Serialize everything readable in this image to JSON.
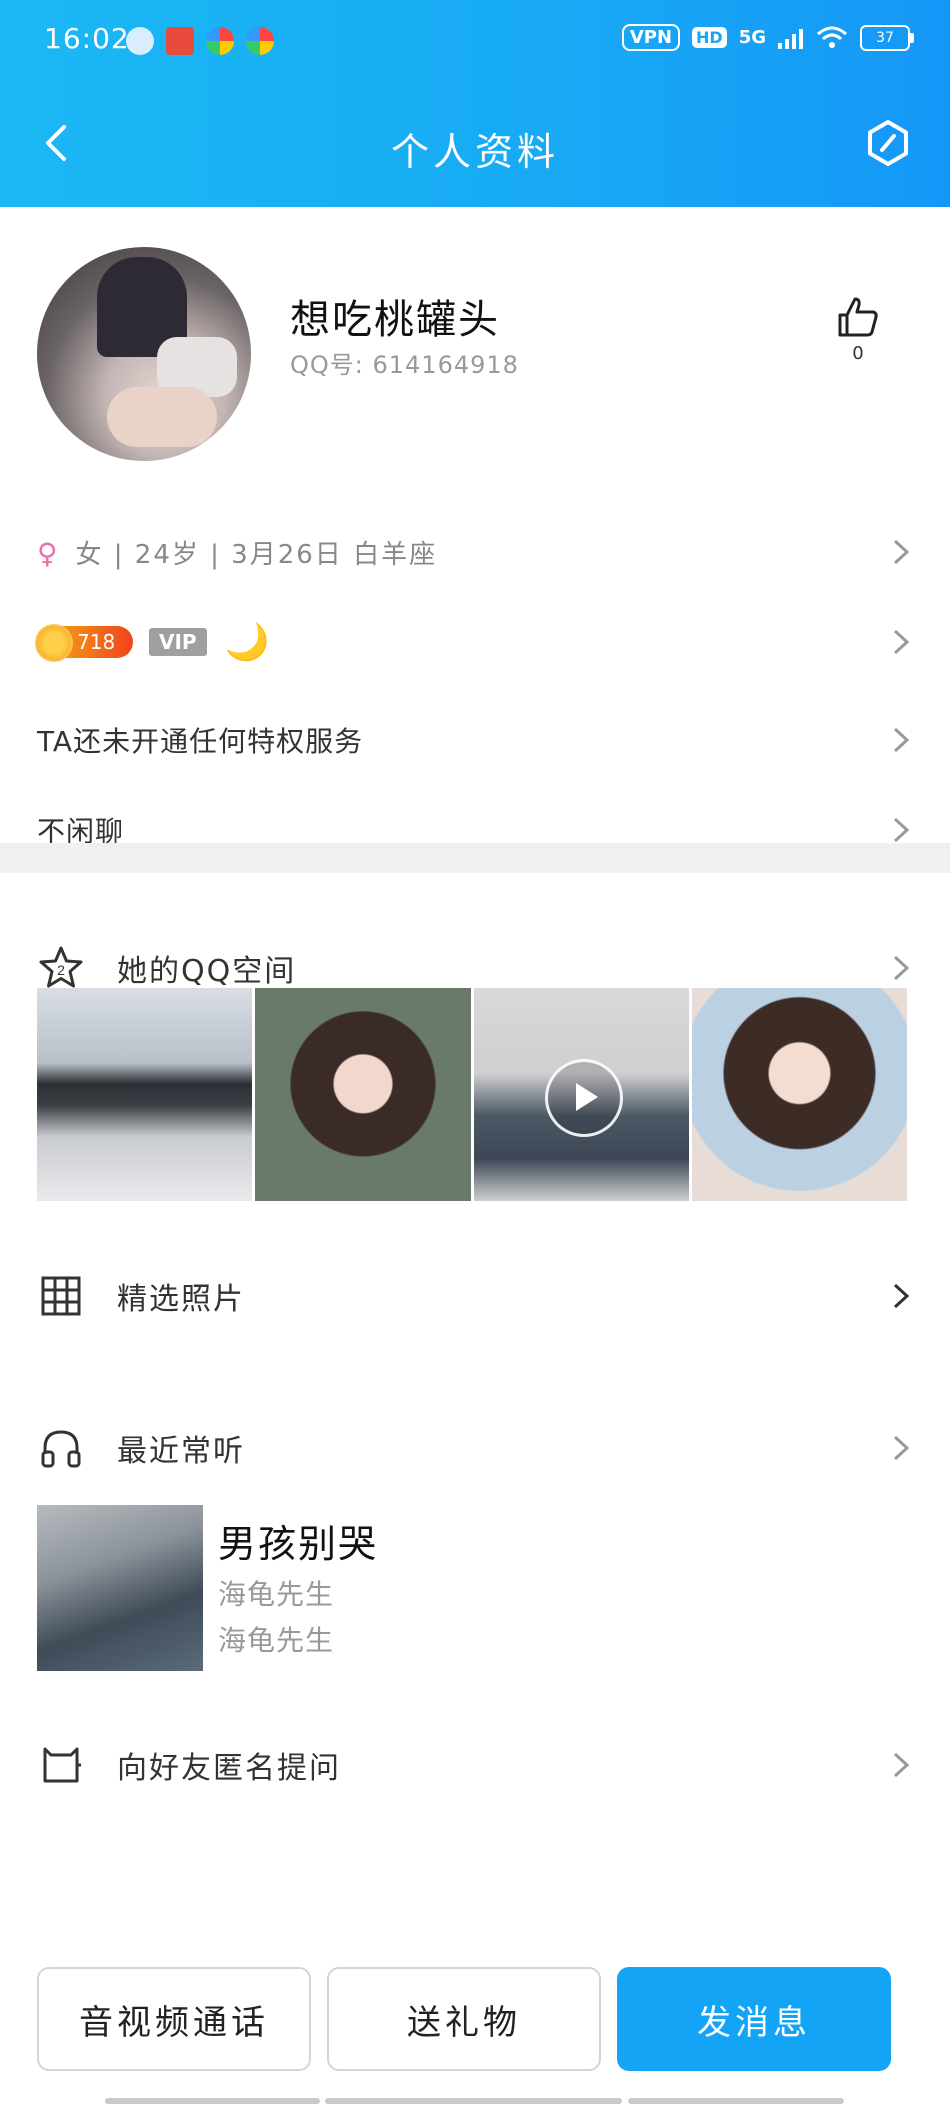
{
  "status_bar": {
    "time": "16:02",
    "vpn": "VPN",
    "hd": "HD",
    "network": "5G",
    "battery": "37"
  },
  "nav": {
    "title": "个人资料"
  },
  "profile": {
    "nickname": "想吃桃罐头",
    "qq_label": "QQ号: 614164918",
    "like_count": "0",
    "info_line": "女 | 24岁 | 3月26日 白羊座",
    "female_symbol": "♀",
    "level": "718",
    "vip": "VIP",
    "moon": "🌙",
    "privilege_text": "TA还未开通任何特权服务",
    "tag_text": "不闲聊"
  },
  "space": {
    "qzone_label": "她的QQ空间",
    "featured_photos_label": "精选照片",
    "recent_music_label": "最近常听",
    "song_title": "男孩别哭",
    "song_artist_1": "海龟先生",
    "song_artist_2": "海龟先生",
    "ask_label": "向好友匿名提问"
  },
  "actions": {
    "video_call": "音视频通话",
    "send_gift": "送礼物",
    "send_message": "发消息"
  },
  "colors": {
    "header_gradient_start": "#1bb8f3",
    "header_gradient_end": "#1597f7",
    "primary_button": "#14a4f6",
    "female": "#e96fb0"
  }
}
